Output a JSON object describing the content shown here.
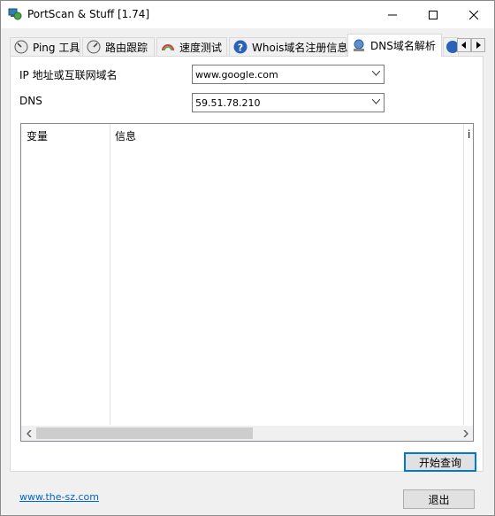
{
  "window": {
    "title": "PortScan & Stuff [1.74]"
  },
  "tabs": [
    {
      "label": "Ping 工具",
      "icon": "ping-gauge-icon"
    },
    {
      "label": "路由跟踪",
      "icon": "traceroute-gauge-icon"
    },
    {
      "label": "速度测试",
      "icon": "speedometer-icon"
    },
    {
      "label": "Whois域名注册信息",
      "icon": "question-icon"
    },
    {
      "label": "DNS域名解析",
      "icon": "dns-network-icon",
      "active": true
    },
    {
      "label": "",
      "icon": "partial-tab-icon"
    }
  ],
  "form": {
    "host_label": "IP 地址或互联网域名",
    "host_value": "www.google.com",
    "dns_label": "DNS",
    "dns_value": "59.51.78.210"
  },
  "results": {
    "columns": [
      "变量",
      "信息",
      "i"
    ],
    "rows": []
  },
  "buttons": {
    "start_query": "开始查询",
    "exit": "退出"
  },
  "footer": {
    "link": "www.the-sz.com"
  },
  "colors": {
    "accent": "#0078d7",
    "link": "#0066cc"
  }
}
